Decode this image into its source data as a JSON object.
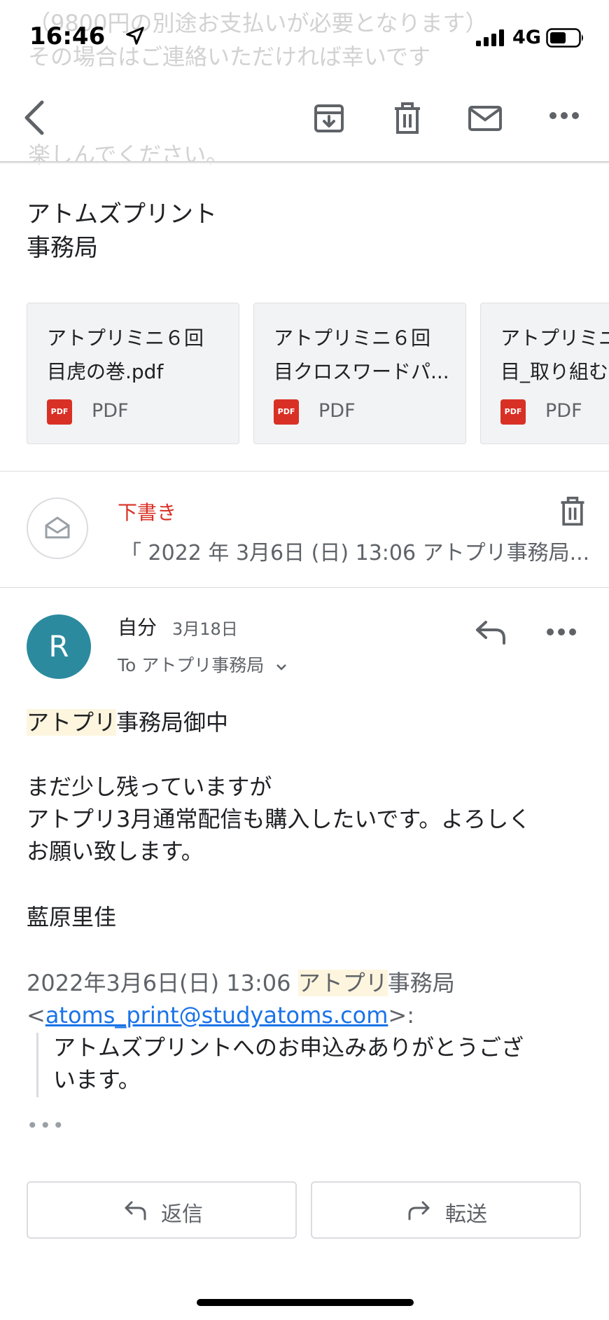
{
  "status_bar": {
    "time": "16:46",
    "network": "4G"
  },
  "background_ghost_text": {
    "line1": "（9800円の別途お支払いが必要となります）",
    "line2": "その場合はご連絡いただければ幸いです",
    "line3": "楽しんでください。"
  },
  "toolbar": {
    "icons": [
      "back-icon",
      "archive-icon",
      "trash-icon",
      "mail-icon",
      "more-icon"
    ]
  },
  "sender_block": {
    "line1": "アトムズプリント",
    "line2": "事務局"
  },
  "attachments": [
    {
      "line1": "アトプリミニ６回",
      "line2": "目虎の巻.pdf",
      "type": "PDF",
      "badge": "PDF"
    },
    {
      "line1": "アトプリミニ６回",
      "line2": "目クロスワードパ...",
      "type": "PDF",
      "badge": "PDF"
    },
    {
      "line1": "アトプリミニ",
      "line2": "目_取り組む",
      "type": "PDF",
      "badge": "PDF"
    }
  ],
  "draft": {
    "label": "下書き",
    "snippet": "「 2022 年 3月6日 (日) 13:06 アトプリ事務局..."
  },
  "message": {
    "avatar_letter": "R",
    "from": "自分",
    "date": "3月18日",
    "to": "To アトプリ事務局",
    "greeting_hl": "アトプリ",
    "greeting_rest": "事務局御中",
    "line1": "まだ少し残っていますが",
    "line2": "アトプリ3月通常配信も購入したいです。よろしく",
    "line3": "お願い致します。",
    "signature": "藍原里佳",
    "quote_date": "2022年3月6日(日) 13:06 ",
    "quote_hl": "アトプリ",
    "quote_sender": "事務局",
    "quote_lt": "<",
    "quote_email": "atoms_print@studyatoms.com",
    "quote_gt": ">:",
    "quote_line1": "アトムズプリントへのお申込みありがとうござ",
    "quote_line2": "います。",
    "ellipsis": "•••"
  },
  "actions": {
    "reply": "返信",
    "forward": "転送"
  },
  "colors": {
    "accent_red": "#d93025",
    "avatar": "#2b8a9e",
    "link": "#1a73e8",
    "highlight": "#fdf5de"
  }
}
